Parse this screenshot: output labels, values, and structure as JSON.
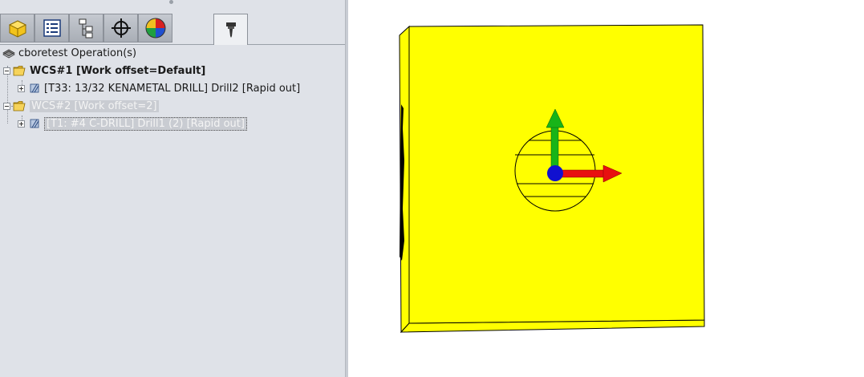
{
  "tabs": [
    {
      "name": "tab-feature-manager",
      "icon": "part-icon"
    },
    {
      "name": "tab-property-manager",
      "icon": "property-list-icon"
    },
    {
      "name": "tab-configuration-manager",
      "icon": "configuration-tree-icon"
    },
    {
      "name": "tab-dimxpert",
      "icon": "crosshair-icon"
    },
    {
      "name": "tab-display-manager",
      "icon": "color-sphere-icon"
    },
    {
      "name": "tab-cam-operation-tree",
      "icon": "drill-tool-icon",
      "active": true
    }
  ],
  "tree": {
    "root": {
      "label": "cboretest Operation(s)",
      "icon": "operations-icon"
    },
    "wcs1": {
      "label": "WCS#1 [Work offset=Default]",
      "icon": "open-folder-icon"
    },
    "op1": {
      "label": "[T33: 13/32 KENAMETAL DRILL] Drill2 [Rapid out]",
      "icon": "drill-operation-icon"
    },
    "wcs2": {
      "label": "WCS#2 [Work offset=2]",
      "icon": "open-folder-icon"
    },
    "op2": {
      "label": "[T1: #4 C-DRILL] Drill1 (2) [Rapid out]",
      "icon": "drill-operation-icon"
    }
  },
  "viewport": {
    "part_color": "#ffff00",
    "axis_x_color": "#e81010",
    "axis_y_color": "#18b418",
    "origin_color": "#1010d0"
  }
}
